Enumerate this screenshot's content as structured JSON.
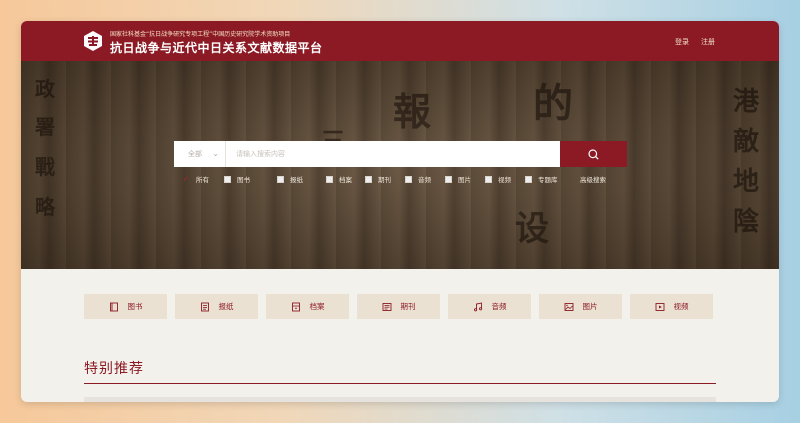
{
  "header": {
    "subtitle": "国家社科基金“抗日战争研究专项工程”中国历史研究院学术资助项目",
    "title": "抗日战争与近代中日关系文献数据平台",
    "login": "登录",
    "register": "注册"
  },
  "search": {
    "scope": "全部",
    "placeholder": "请输入搜索内容",
    "advanced": "高级搜索",
    "filters": [
      {
        "label": "所有",
        "checked": true
      },
      {
        "label": "图书",
        "checked": false
      },
      {
        "label": "报纸",
        "checked": false
      },
      {
        "label": "档案",
        "checked": false
      },
      {
        "label": "期刊",
        "checked": false
      },
      {
        "label": "音频",
        "checked": false
      },
      {
        "label": "图片",
        "checked": false
      },
      {
        "label": "视频",
        "checked": false
      },
      {
        "label": "专题库",
        "checked": false
      }
    ]
  },
  "categories": [
    {
      "label": "图书",
      "icon": "book-icon"
    },
    {
      "label": "报纸",
      "icon": "newspaper-icon"
    },
    {
      "label": "档案",
      "icon": "archive-icon"
    },
    {
      "label": "期刊",
      "icon": "journal-icon"
    },
    {
      "label": "音频",
      "icon": "music-icon"
    },
    {
      "label": "图片",
      "icon": "image-icon"
    },
    {
      "label": "视频",
      "icon": "video-icon"
    }
  ],
  "recommend": {
    "title": "特别推荐"
  },
  "colors": {
    "brand": "#8c1a24",
    "category_bg": "#ebe1d3",
    "page_bg": "#f3f1ec"
  }
}
